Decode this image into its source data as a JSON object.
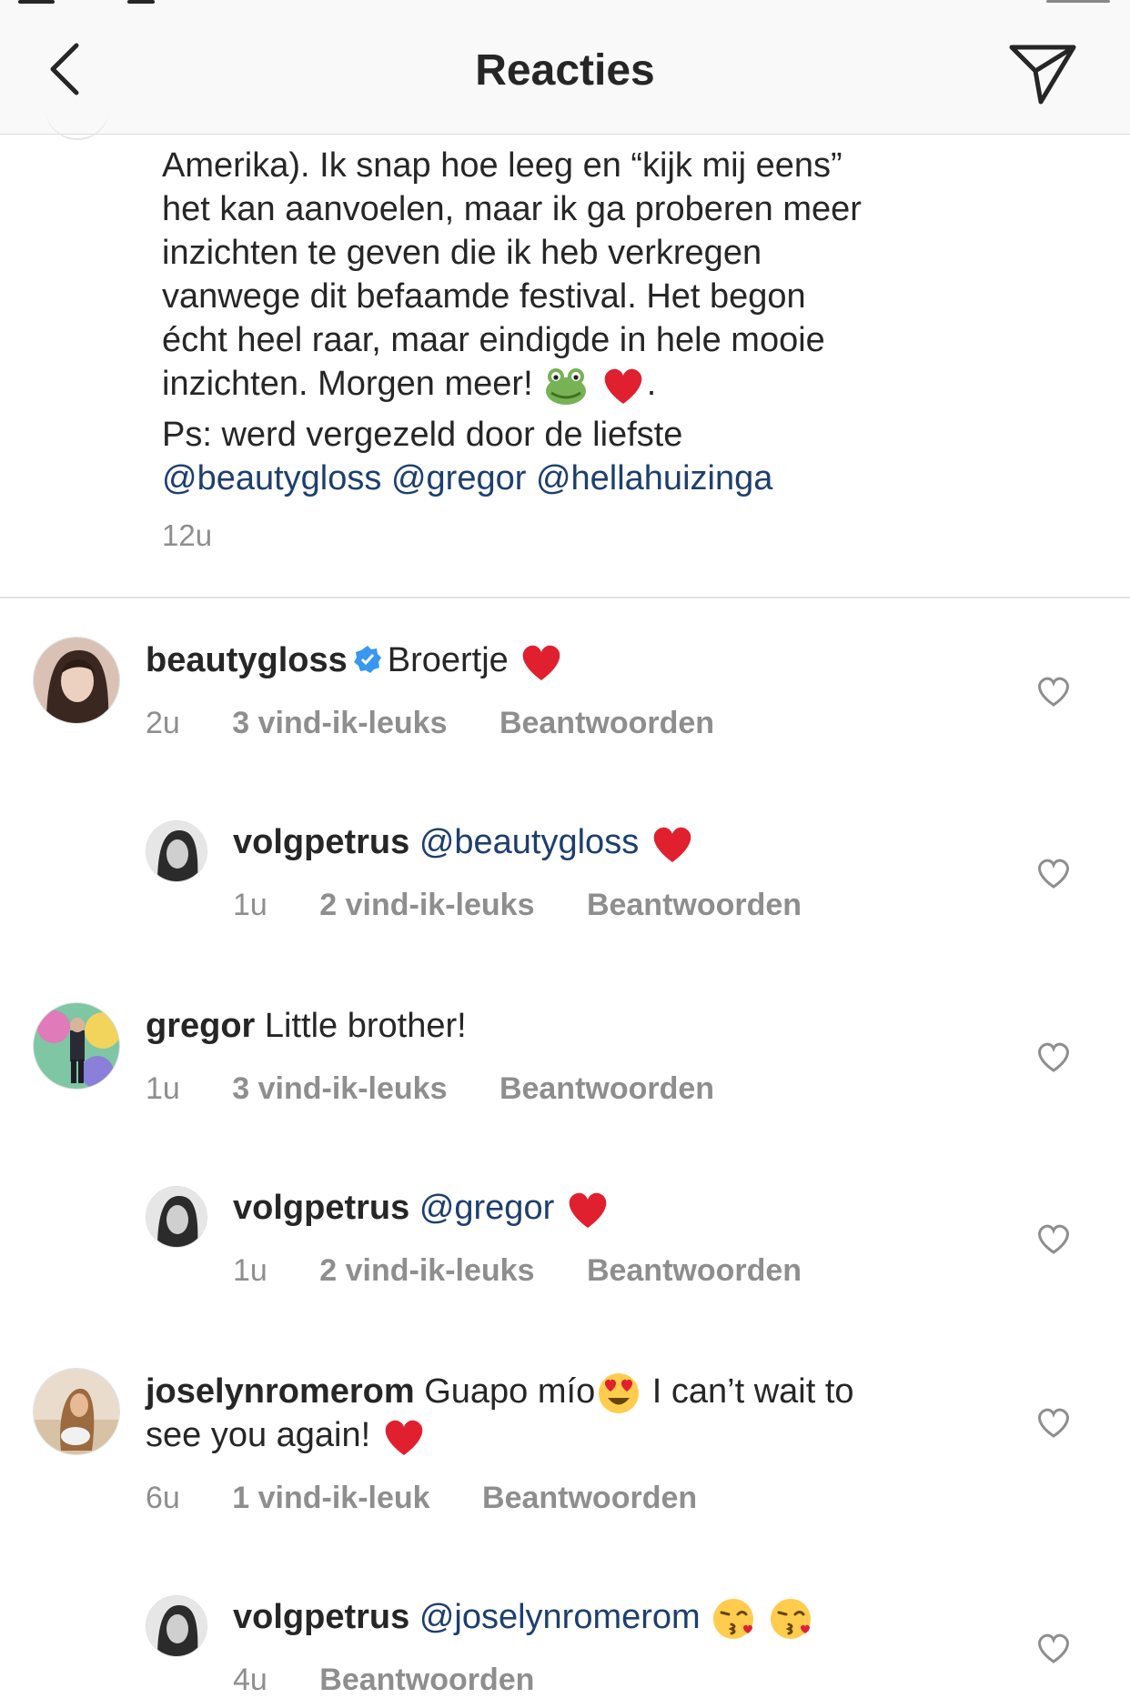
{
  "header": {
    "title": "Reacties",
    "back_icon": "chevron-left-icon",
    "share_icon": "paper-plane-icon"
  },
  "caption": {
    "lines": [
      "Amerika). Ik snap hoe leeg en “kijk mij eens”",
      "het kan aanvoelen, maar ik ga proberen meer",
      "inzichten te geven die ik heb verkregen",
      "vanwege dit befaamde festival. Het begon",
      "écht heel raar, maar eindigde in hele mooie",
      "inzichten. Morgen meer!"
    ],
    "ps_text": "Ps: werd vergezeld door de liefste",
    "mentions": [
      "@beautygloss",
      "@gregor",
      "@hellahuizinga"
    ],
    "time": "12u"
  },
  "comments": [
    {
      "username": "beautygloss",
      "verified": true,
      "text": "Broertje",
      "time": "2u",
      "likes": "3 vind-ik-leuks",
      "reply_label": "Beantwoorden",
      "avatar_colors": [
        "#3b2a24",
        "#e8c9b8"
      ]
    },
    {
      "username": "volgpetrus",
      "mention": "@beautygloss",
      "time": "1u",
      "likes": "2 vind-ik-leuks",
      "reply_label": "Beantwoorden"
    },
    {
      "username": "gregor",
      "text": "Little brother!",
      "time": "1u",
      "likes": "3 vind-ik-leuks",
      "reply_label": "Beantwoorden"
    },
    {
      "username": "volgpetrus",
      "mention": "@gregor",
      "time": "1u",
      "likes": "2 vind-ik-leuks",
      "reply_label": "Beantwoorden"
    },
    {
      "username": "joselynromerom",
      "text": "Guapo mío",
      "text2": " I can’t wait to",
      "text3": "see you again!",
      "time": "6u",
      "likes": "1 vind-ik-leuk",
      "reply_label": "Beantwoorden"
    },
    {
      "username": "volgpetrus",
      "mention": "@joselynromerom",
      "time": "4u",
      "reply_label": "Beantwoorden"
    }
  ],
  "colors": {
    "text": "#262626",
    "secondary": "#8e8e8e",
    "mention": "#1d3f6e",
    "verified": "#3897f0",
    "heart": "#e0202f"
  }
}
